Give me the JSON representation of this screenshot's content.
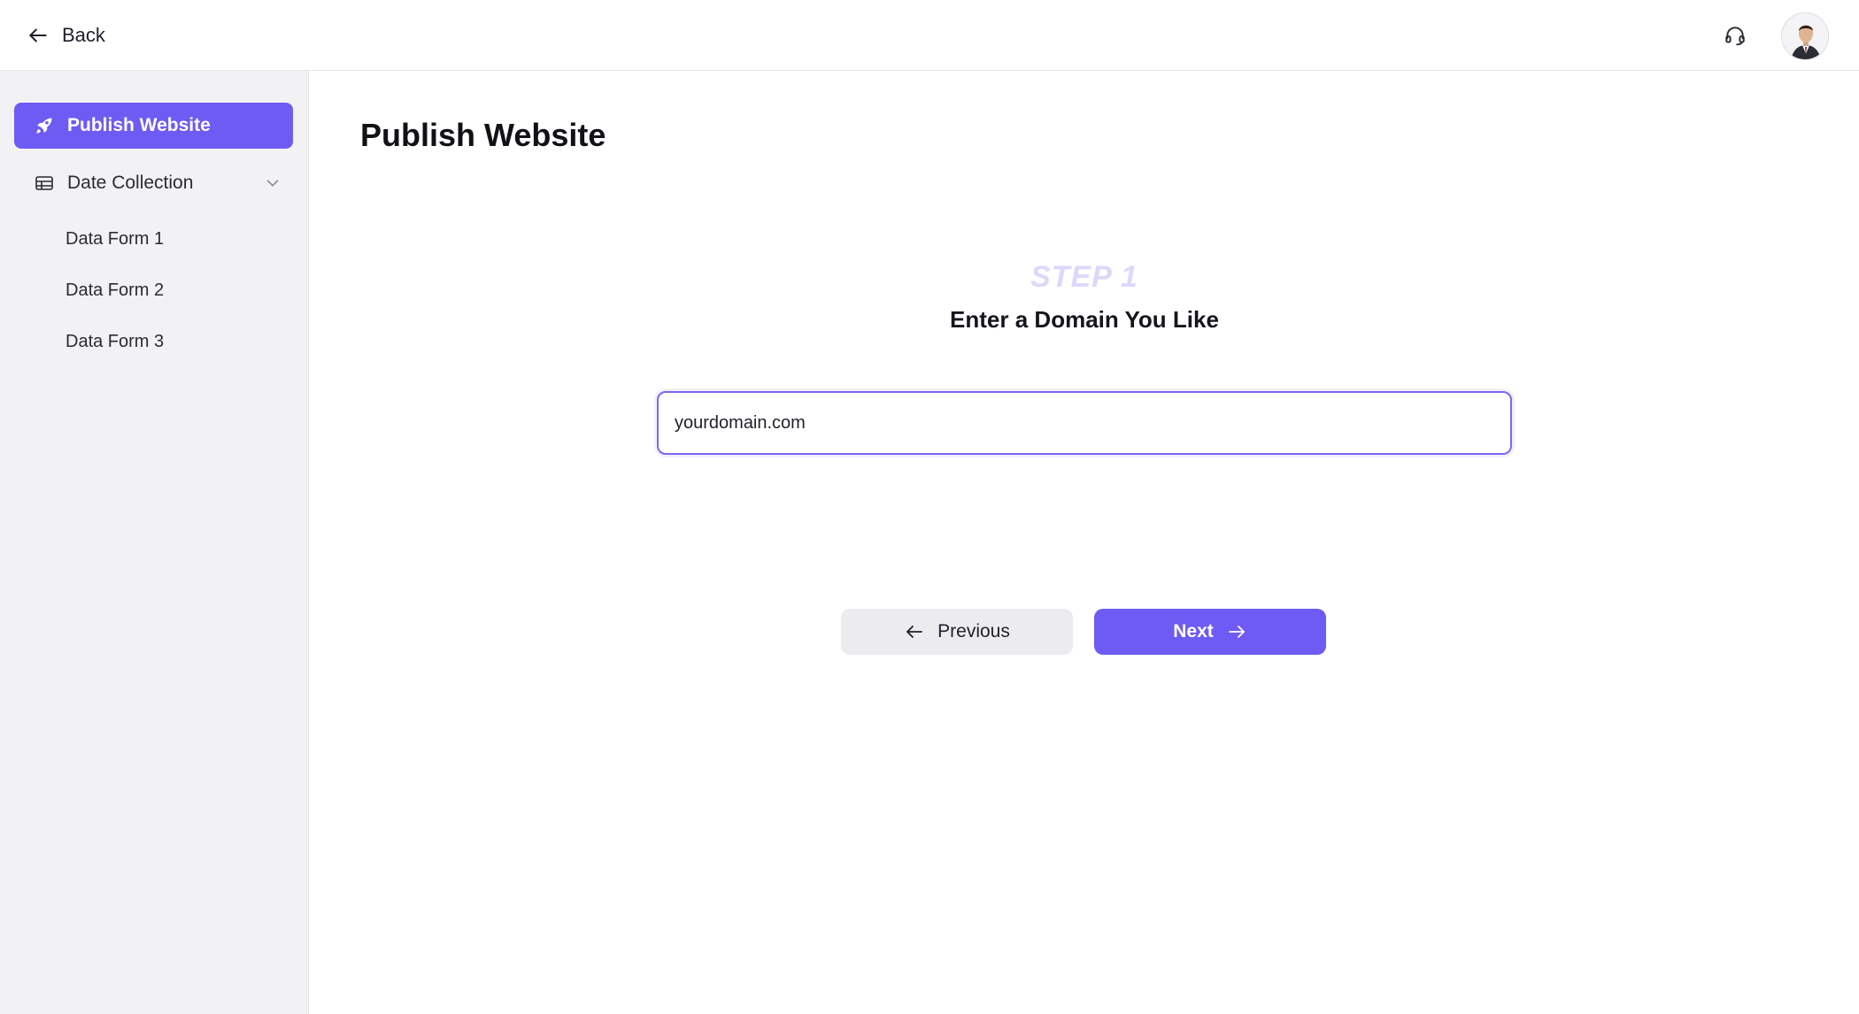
{
  "header": {
    "back_label": "Back",
    "icons": [
      "arrow-left-icon",
      "headset-icon"
    ],
    "avatar": "user-avatar"
  },
  "sidebar": {
    "active_item": {
      "label": "Publish Website",
      "icon": "rocket-icon"
    },
    "group": {
      "label": "Date Collection",
      "icon": "table-icon",
      "expanded": true
    },
    "sub_items": [
      {
        "label": "Data Form 1"
      },
      {
        "label": "Data Form 2"
      },
      {
        "label": "Data Form 3"
      }
    ]
  },
  "main": {
    "title": "Publish Website",
    "step_label": "STEP 1",
    "step_heading": "Enter a Domain You Like",
    "domain_input": {
      "value": "yourdomain.com"
    },
    "buttons": {
      "previous_label": "Previous",
      "next_label": "Next"
    }
  },
  "colors": {
    "accent": "#6e5bf3",
    "step_label": "#ddd8fb",
    "sidebar_bg": "#f2f2f4"
  }
}
